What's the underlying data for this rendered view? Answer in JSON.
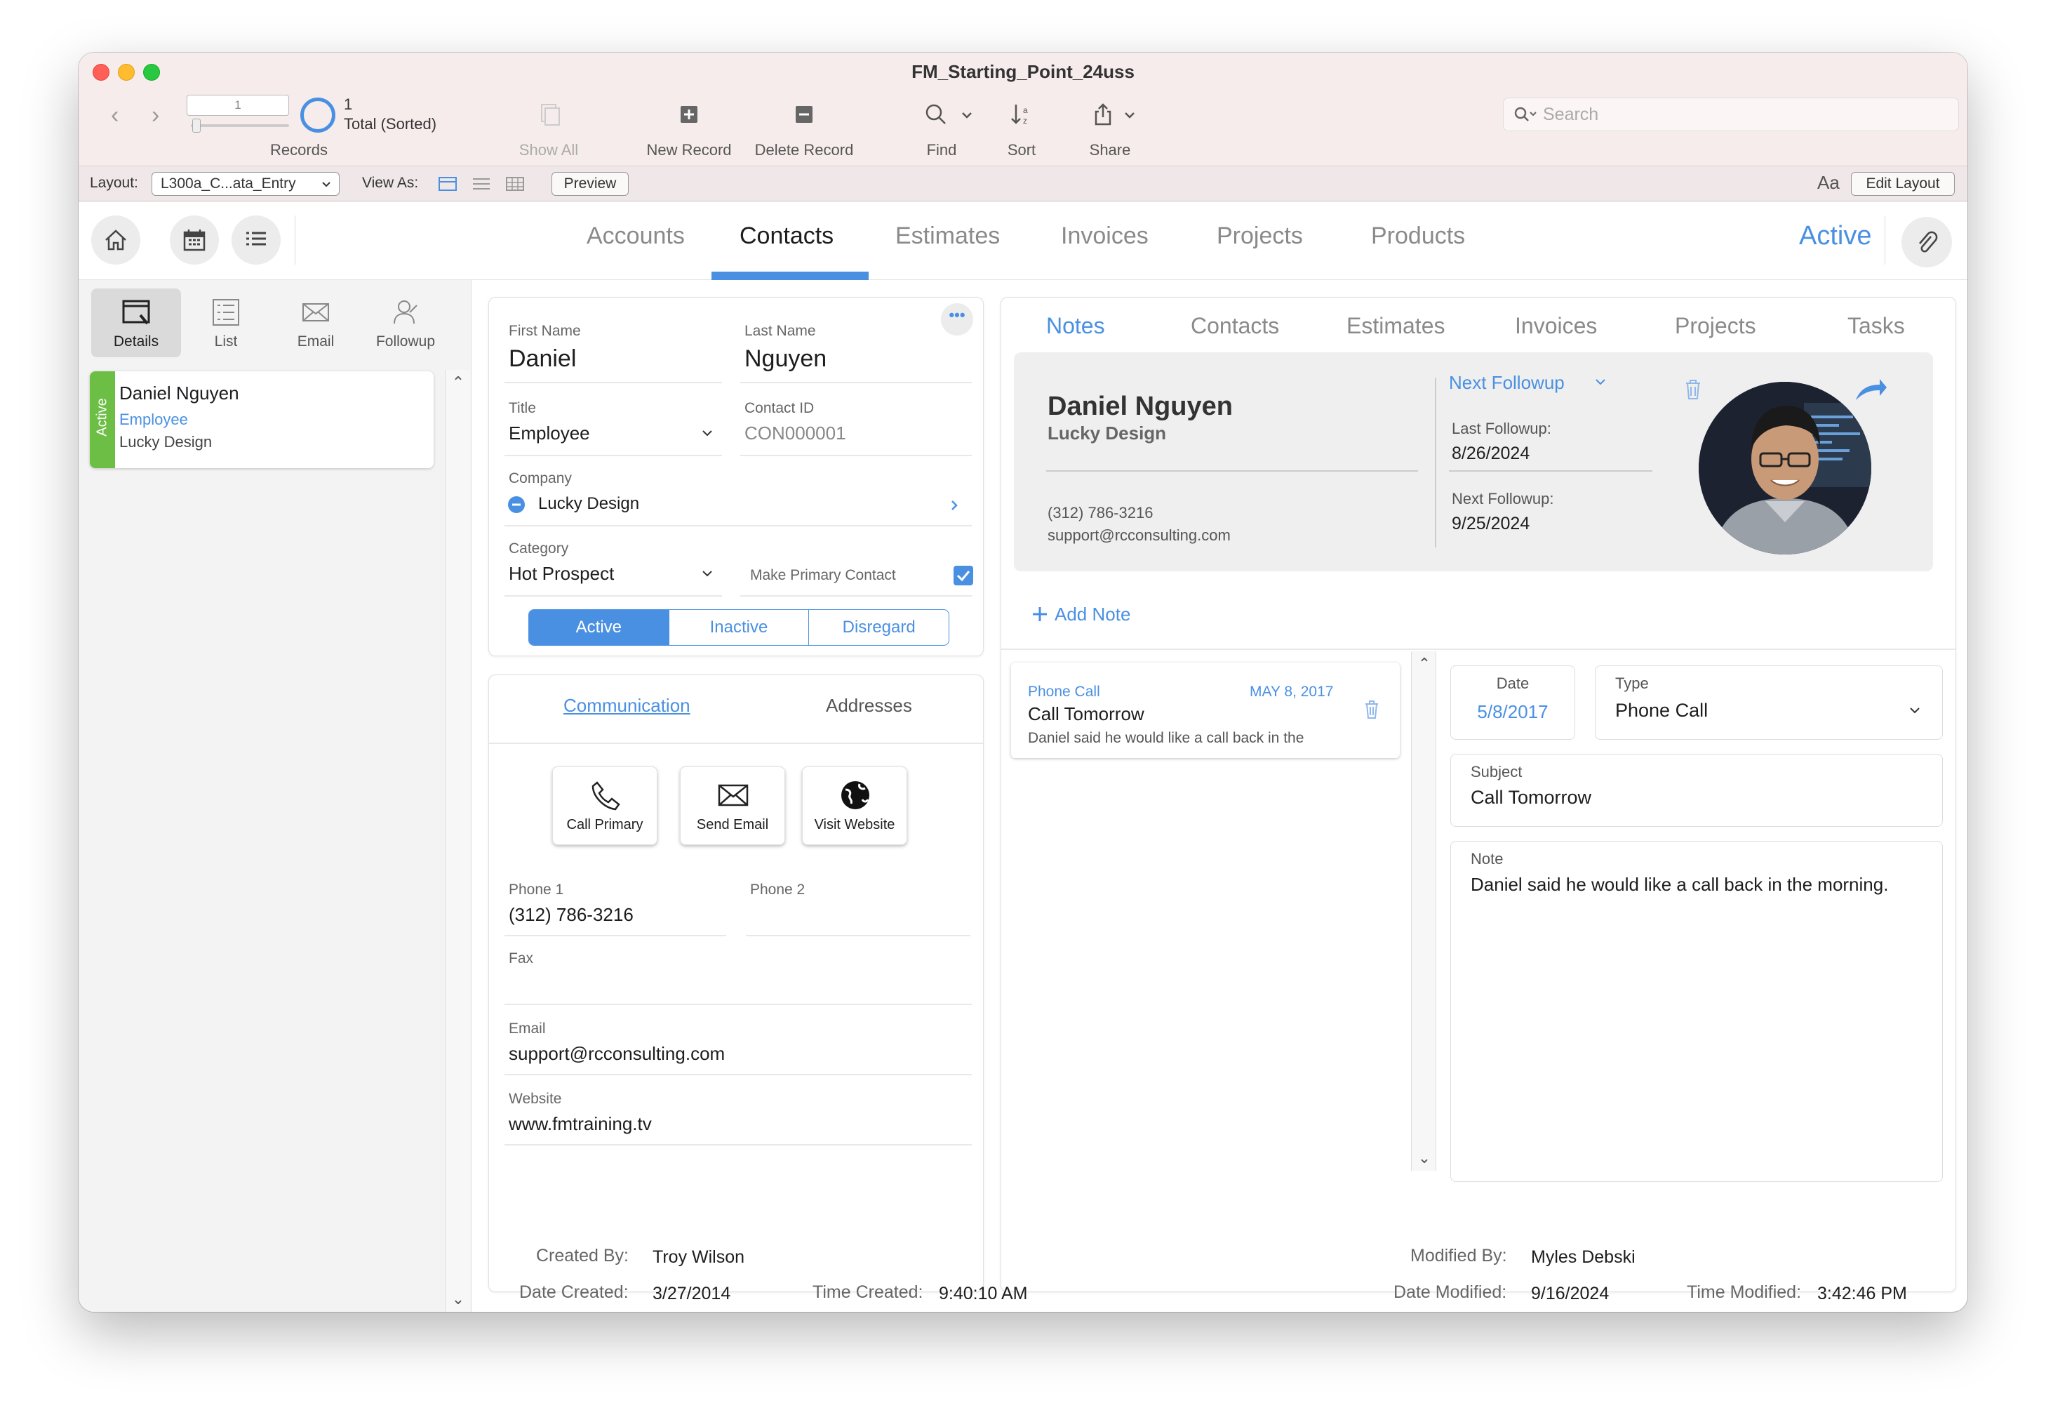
{
  "window": {
    "title": "FM_Starting_Point_24uss"
  },
  "toolbar": {
    "record_input": "1",
    "record_total": "1",
    "record_status": "Total (Sorted)",
    "records_label": "Records",
    "show_all": "Show All",
    "new_record": "New Record",
    "delete_record": "Delete Record",
    "find": "Find",
    "sort": "Sort",
    "share": "Share",
    "search_placeholder": "Search"
  },
  "layoutbar": {
    "layout_label": "Layout:",
    "layout_value": "L300a_C...ata_Entry",
    "view_as_label": "View As:",
    "preview": "Preview",
    "font_glyph": "Aa",
    "edit_layout": "Edit Layout"
  },
  "topnav": {
    "tabs": [
      "Accounts",
      "Contacts",
      "Estimates",
      "Invoices",
      "Projects",
      "Products"
    ],
    "selected": "Contacts",
    "status": "Active"
  },
  "sidebar": {
    "tabs": [
      "Details",
      "List",
      "Email",
      "Followup"
    ],
    "record": {
      "status": "Active",
      "name": "Daniel Nguyen",
      "title": "Employee",
      "company": "Lucky Design"
    }
  },
  "contact": {
    "first_name_label": "First Name",
    "first_name": "Daniel",
    "last_name_label": "Last Name",
    "last_name": "Nguyen",
    "title_label": "Title",
    "title": "Employee",
    "contact_id_label": "Contact ID",
    "contact_id": "CON000001",
    "company_label": "Company",
    "company": "Lucky Design",
    "category_label": "Category",
    "category": "Hot Prospect",
    "primary_contact_label": "Make Primary Contact",
    "status_options": [
      "Active",
      "Inactive",
      "Disregard"
    ],
    "status_selected": "Active"
  },
  "communication": {
    "tabs": [
      "Communication",
      "Addresses"
    ],
    "actions": [
      "Call Primary",
      "Send Email",
      "Visit Website"
    ],
    "phone1_label": "Phone 1",
    "phone1": "(312) 786-3216",
    "phone2_label": "Phone 2",
    "phone2": "",
    "fax_label": "Fax",
    "fax": "",
    "email_label": "Email",
    "email": "support@rcconsulting.com",
    "website_label": "Website",
    "website": "www.fmtraining.tv"
  },
  "right_panel": {
    "tabs": [
      "Notes",
      "Contacts",
      "Estimates",
      "Invoices",
      "Projects",
      "Tasks"
    ],
    "selected_tab": "Notes",
    "header": {
      "name": "Daniel Nguyen",
      "company": "Lucky Design",
      "phone": "(312) 786-3216",
      "email": "support@rcconsulting.com",
      "followup_select": "Next Followup",
      "last_followup_label": "Last Followup:",
      "last_followup": "8/26/2024",
      "next_followup_label": "Next Followup:",
      "next_followup": "9/25/2024"
    },
    "add_note": "Add Note",
    "notes": [
      {
        "type": "Phone Call",
        "date": "MAY 8, 2017",
        "subject": "Call Tomorrow",
        "preview": "Daniel said he would like a call back in the"
      }
    ],
    "detail": {
      "date_label": "Date",
      "date": "5/8/2017",
      "type_label": "Type",
      "type": "Phone Call",
      "subject_label": "Subject",
      "subject": "Call Tomorrow",
      "note_label": "Note",
      "note": "Daniel said he would like a call back in the morning."
    }
  },
  "footer": {
    "created_by_label": "Created By:",
    "created_by": "Troy Wilson",
    "date_created_label": "Date Created:",
    "date_created": "3/27/2014",
    "time_created_label": "Time Created:",
    "time_created": "9:40:10 AM",
    "modified_by_label": "Modified By:",
    "modified_by": "Myles Debski",
    "date_modified_label": "Date Modified:",
    "date_modified": "9/16/2024",
    "time_modified_label": "Time Modified:",
    "time_modified": "3:42:46 PM"
  },
  "colors": {
    "accent": "#4a90e2",
    "active_green": "#6cbf44",
    "titlebar": "#f7ecec"
  },
  "icons": [
    "home-icon",
    "calendar-icon",
    "list-icon",
    "paperclip-icon",
    "search-icon",
    "sort-icon",
    "share-icon",
    "phone-icon",
    "envelope-icon",
    "globe-icon",
    "trash-icon",
    "arrow-icon",
    "plus-icon",
    "checkbox-icon"
  ]
}
